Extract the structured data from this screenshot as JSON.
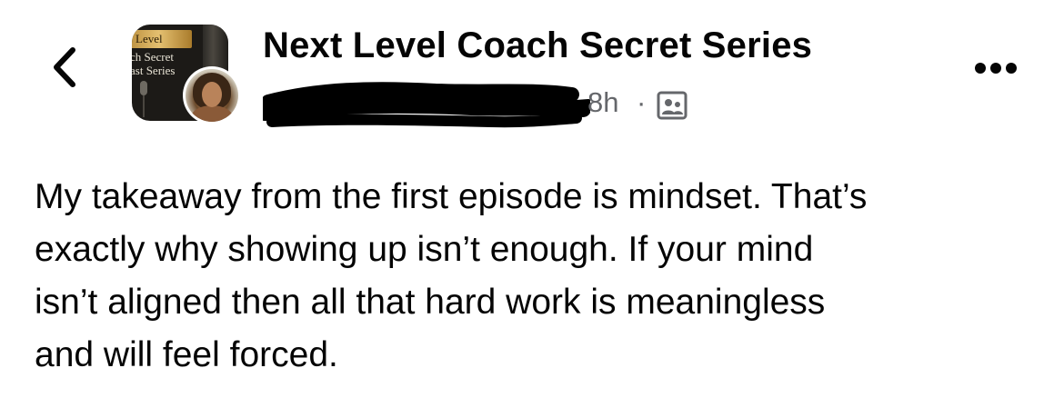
{
  "header": {
    "group_name": "Next Level Coach Secret Series",
    "timestamp": "8h",
    "separator": "·",
    "author_name_redacted": true,
    "back_icon": "chevron-left-icon",
    "privacy_icon": "members-only-icon",
    "more_icon": "more-horizontal-icon"
  },
  "group_avatar": {
    "line1": "Level",
    "line2": "ch Secret",
    "line3": "ast Series"
  },
  "post": {
    "text": "My takeaway from the first episode is mindset. That’s\nexactly why showing up isn’t enough. If your mind\nisn’t aligned then all that hard work is meaningless\nand will feel forced."
  },
  "colors": {
    "text_primary": "#050505",
    "text_secondary": "#65676b",
    "background": "#ffffff"
  }
}
